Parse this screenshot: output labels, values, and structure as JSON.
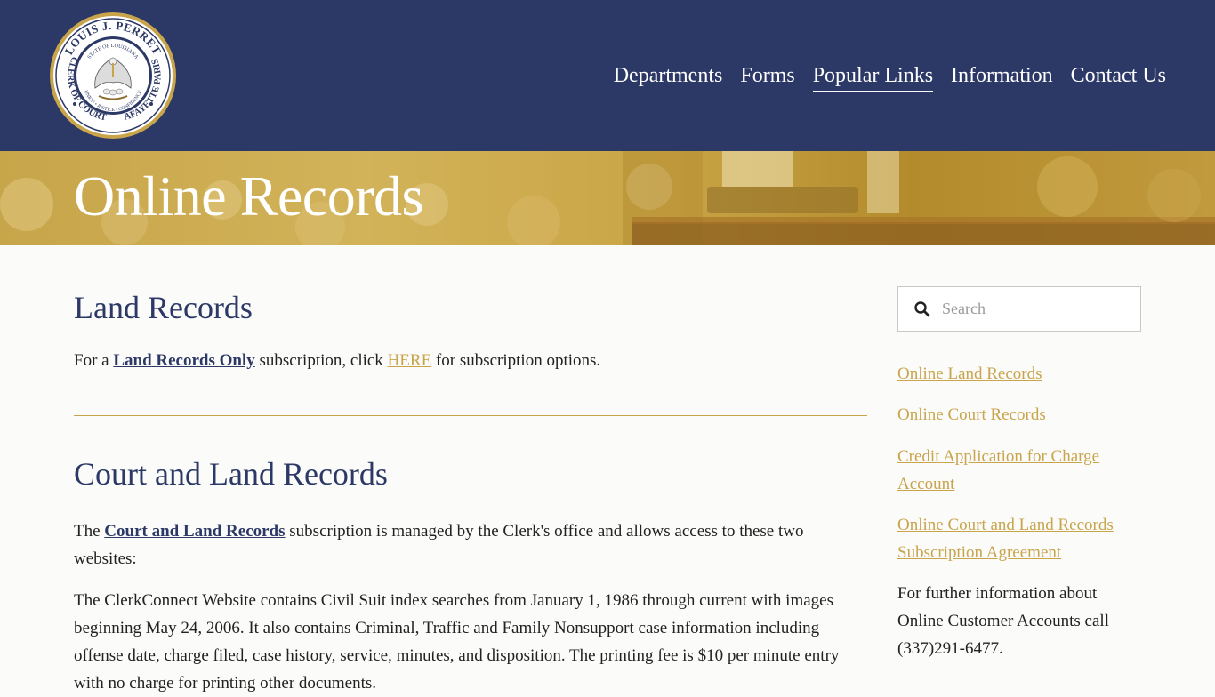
{
  "header": {
    "logo": {
      "top_text": "LOUIS J. PERRET",
      "inner_top": "STATE OF LOUISIANA",
      "inner_bottom": "UNION • JUSTICE • CONFIDENCE",
      "left_text": "CLERK OF COURT",
      "right_text": "LAFAYETTE PARISH"
    },
    "nav": [
      {
        "label": "Departments"
      },
      {
        "label": "Forms"
      },
      {
        "label": "Popular Links"
      },
      {
        "label": "Information"
      },
      {
        "label": "Contact Us"
      }
    ]
  },
  "banner": {
    "title": "Online Records"
  },
  "main": {
    "land": {
      "heading": "Land Records",
      "text_before": "For a ",
      "link1": "Land Records Only",
      "text_mid": " subscription, click ",
      "link2": "HERE",
      "text_after": " for subscription options."
    },
    "court": {
      "heading": "Court and Land Records",
      "p1_before": "The ",
      "p1_link": "Court and Land Records",
      "p1_after": " subscription is managed by the Clerk's office and allows access to these two websites:",
      "p2": "The ClerkConnect Website contains Civil Suit index searches from January 1, 1986 through current with images beginning May 24, 2006. It also contains Criminal, Traffic and Family Nonsupport case information including offense date, charge filed, case history, service, minutes, and disposition. The printing fee is $10 per minute entry with no charge for printing other documents."
    }
  },
  "sidebar": {
    "search_placeholder": "Search",
    "links": [
      {
        "label": "Online Land Records"
      },
      {
        "label": "Online Court Records"
      },
      {
        "label": "Credit Application for Charge Account"
      },
      {
        "label": "Online Court and Land Records Subscription Agreement"
      }
    ],
    "info_text": "For further information about Online Customer Accounts call (337)291-6477."
  },
  "colors": {
    "navy": "#2c3966",
    "gold": "#c8a44b"
  }
}
